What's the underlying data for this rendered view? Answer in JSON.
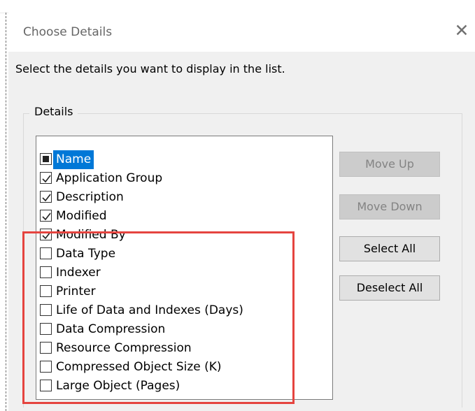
{
  "dialog": {
    "title": "Choose Details",
    "close_glyph": "✕",
    "instructions": "Select the details you want to display in the list.",
    "group_label": "Details"
  },
  "details": [
    {
      "label": "Name",
      "state": "indeterminate",
      "selected": true
    },
    {
      "label": "Application Group",
      "state": "checked"
    },
    {
      "label": "Description",
      "state": "checked"
    },
    {
      "label": "Modified",
      "state": "checked"
    },
    {
      "label": "Modified By",
      "state": "checked"
    },
    {
      "label": "Data Type",
      "state": "unchecked"
    },
    {
      "label": "Indexer",
      "state": "unchecked"
    },
    {
      "label": "Printer",
      "state": "unchecked"
    },
    {
      "label": "Life of Data and Indexes (Days)",
      "state": "unchecked"
    },
    {
      "label": "Data Compression",
      "state": "unchecked"
    },
    {
      "label": "Resource Compression",
      "state": "unchecked"
    },
    {
      "label": "Compressed Object Size (K)",
      "state": "unchecked"
    },
    {
      "label": "Large Object (Pages)",
      "state": "unchecked"
    }
  ],
  "buttons": {
    "move_up": "Move Up",
    "move_down": "Move Down",
    "select_all": "Select All",
    "deselect_all": "Deselect All"
  },
  "colors": {
    "selection": "#0078d7",
    "highlight_box": "#e5443f"
  }
}
